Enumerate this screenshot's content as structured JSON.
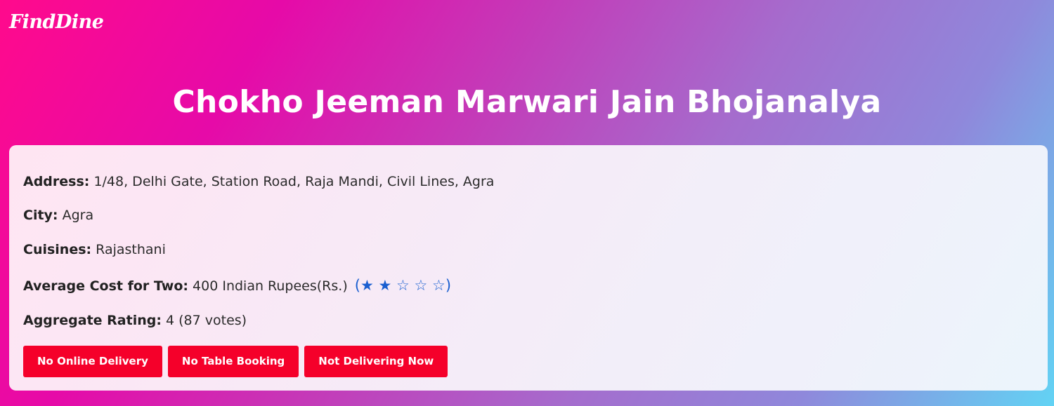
{
  "header": {
    "logo_text": "FindDine"
  },
  "restaurant": {
    "name": "Chokho Jeeman Marwari Jain Bhojanalya",
    "address_label": "Address:",
    "address": "1/48, Delhi Gate, Station Road, Raja Mandi, Civil Lines, Agra",
    "city_label": "City:",
    "city": "Agra",
    "cuisines_label": "Cuisines:",
    "cuisines": "Rajasthani",
    "cost_label": "Average Cost for Two:",
    "cost": "400 Indian Rupees(Rs.)",
    "price_stars": "(★ ★ ☆ ☆ ☆)",
    "price_level": 2,
    "price_level_max": 5,
    "rating_label": "Aggregate Rating:",
    "rating": "4 (87 votes)"
  },
  "tags": [
    "No Online Delivery",
    "No Table Booking",
    "Not Delivering Now"
  ],
  "colors": {
    "tag_background": "#f5002a",
    "star_color": "#1a5fd0",
    "gradient_start": "#ff0a8c",
    "gradient_end": "#62d3f4"
  }
}
